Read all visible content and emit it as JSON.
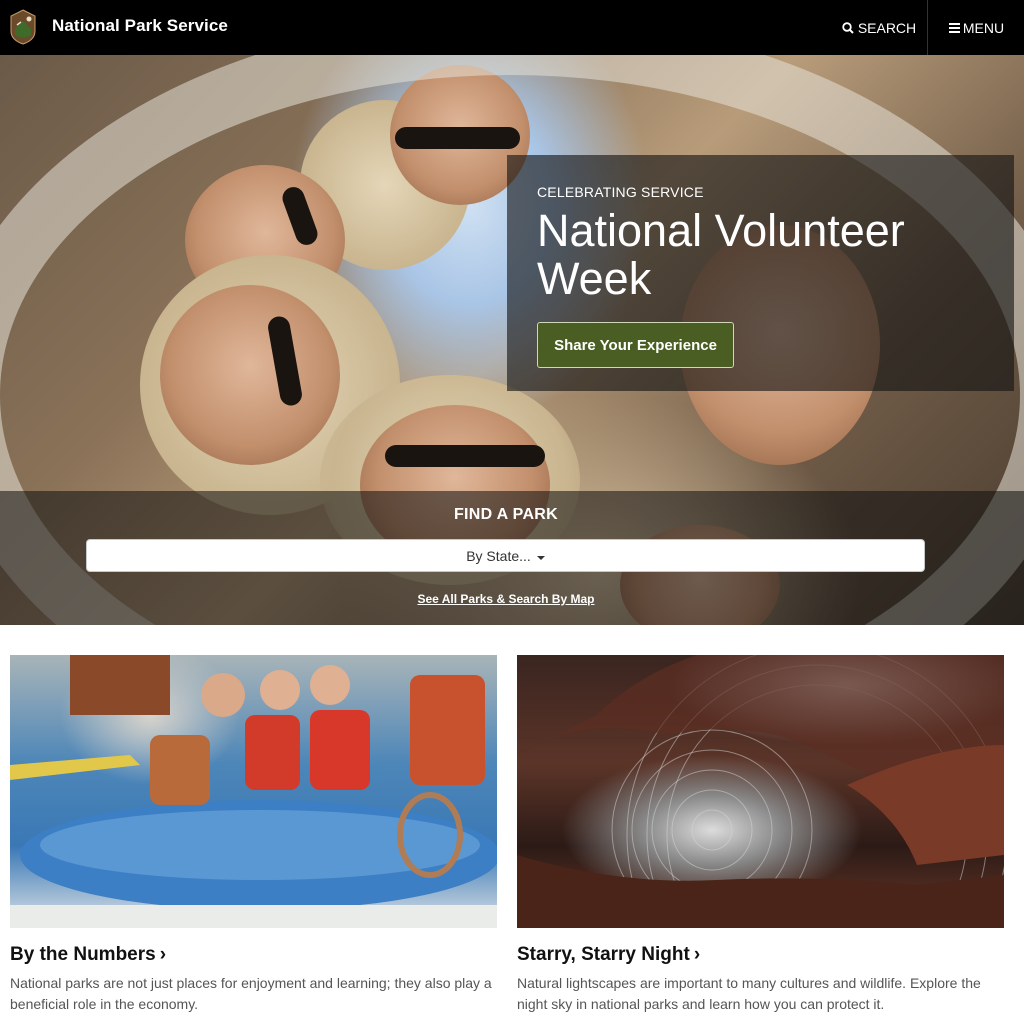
{
  "header": {
    "site_title": "National Park Service",
    "search_label": "SEARCH",
    "menu_label": "MENU",
    "logo_icon": "arrowhead-logo-icon"
  },
  "hero": {
    "eyebrow": "CELEBRATING SERVICE",
    "headline": "National Volunteer Week",
    "cta_label": "Share Your Experience",
    "cta_color": "#4a5e23"
  },
  "find_park": {
    "label": "FIND A PARK",
    "select_value": "By State...",
    "map_link": "See All Parks & Search By Map"
  },
  "cards": [
    {
      "title": "By the Numbers",
      "chevron": "›",
      "text": "National parks are not just places for enjoyment and learning; they also play a beneficial role in the economy."
    },
    {
      "title": "Starry, Starry Night",
      "chevron": "›",
      "text": "Natural lightscapes are important to many cultures and wildlife. Explore the night sky in national parks and learn how you can protect it."
    }
  ]
}
